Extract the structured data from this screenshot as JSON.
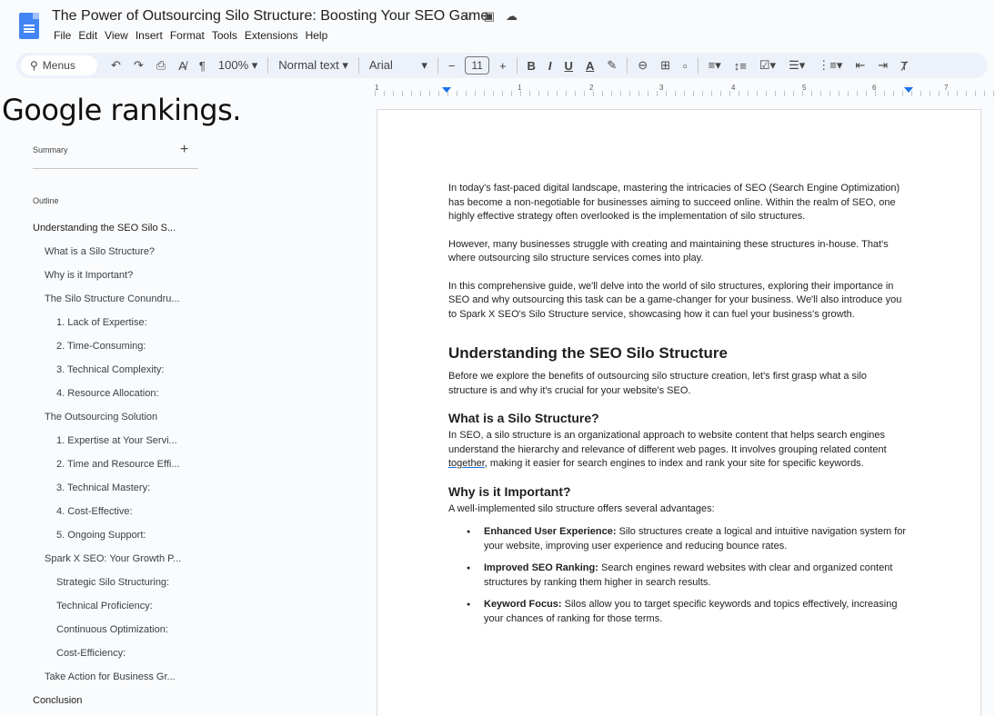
{
  "app": {
    "doc_title": "The Power of Outsourcing Silo Structure: Boosting Your SEO Game",
    "menu": [
      "File",
      "Edit",
      "View",
      "Insert",
      "Format",
      "Tools",
      "Extensions",
      "Help"
    ]
  },
  "toolbar": {
    "search_label": "Menus",
    "zoom": "100%",
    "style": "Normal text",
    "font": "Arial",
    "font_size": "11",
    "minus": "−",
    "plus": "+",
    "bold": "B",
    "italic": "I",
    "underline": "U",
    "text_color": "A"
  },
  "ruler": {
    "numbers": [
      "1",
      "1",
      "2",
      "3",
      "4",
      "5",
      "6",
      "7"
    ]
  },
  "overlay_text": "Google rankings.",
  "sidebar": {
    "summary_label": "Summary",
    "summary_add": "+",
    "outline_label": "Outline",
    "items": [
      {
        "label": "Understanding the SEO Silo S...",
        "level": 1
      },
      {
        "label": "What is a Silo Structure?",
        "level": 2
      },
      {
        "label": "Why is it Important?",
        "level": 2
      },
      {
        "label": "The Silo Structure Conundru...",
        "level": 2
      },
      {
        "label": "1. Lack of Expertise:",
        "level": 3
      },
      {
        "label": "2. Time-Consuming:",
        "level": 3
      },
      {
        "label": "3. Technical Complexity:",
        "level": 3
      },
      {
        "label": "4. Resource Allocation:",
        "level": 3
      },
      {
        "label": "The Outsourcing Solution",
        "level": 2
      },
      {
        "label": "1. Expertise at Your Servi...",
        "level": 3
      },
      {
        "label": "2. Time and Resource Effi...",
        "level": 3
      },
      {
        "label": "3. Technical Mastery:",
        "level": 3
      },
      {
        "label": "4. Cost-Effective:",
        "level": 3
      },
      {
        "label": "5. Ongoing Support:",
        "level": 3
      },
      {
        "label": "Spark X SEO: Your Growth P...",
        "level": 2
      },
      {
        "label": "Strategic Silo Structuring:",
        "level": 3
      },
      {
        "label": "Technical Proficiency:",
        "level": 3
      },
      {
        "label": "Continuous Optimization:",
        "level": 3
      },
      {
        "label": "Cost-Efficiency:",
        "level": 3
      },
      {
        "label": "Take Action for Business Gr...",
        "level": 2
      },
      {
        "label": "Conclusion",
        "level": 1
      }
    ]
  },
  "doc": {
    "intro_1": "In today's fast-paced digital landscape, mastering the intricacies of SEO (Search Engine Optimization) has become a non-negotiable for businesses aiming to succeed online. Within the realm of SEO, one highly effective strategy often overlooked is the implementation of silo structures.",
    "intro_2": "However, many businesses struggle with creating and maintaining these structures in-house. That's where outsourcing silo structure services comes into play.",
    "intro_3": "In this comprehensive guide, we'll delve into the world of silo structures, exploring their importance in SEO and why outsourcing this task can be a game-changer for your business. We'll also introduce you to Spark X SEO's Silo Structure service, showcasing how it can fuel your business's growth.",
    "h_understanding": "Understanding the SEO Silo Structure",
    "understanding_p": "Before we explore the benefits of outsourcing silo structure creation, let's first grasp what a silo structure is and why it's crucial for your website's SEO.",
    "h_what": "What is a Silo Structure?",
    "what_p_a": "In SEO, a silo structure is an organizational approach to website content that helps search engines understand the hierarchy and relevance of different web pages. It involves grouping related content ",
    "what_p_under": "together",
    "what_p_b": ", making it easier for search engines to index and rank your site for specific keywords.",
    "h_why": "Why is it Important?",
    "why_p": "A well-implemented silo structure offers several advantages:",
    "bullets": [
      {
        "bold": "Enhanced User Experience:",
        "text": " Silo structures create a logical and intuitive navigation system for your website, improving user experience and reducing bounce rates."
      },
      {
        "bold": "Improved SEO Ranking:",
        "text": " Search engines reward websites with clear and organized content structures by ranking them higher in search results."
      },
      {
        "bold": "Keyword Focus:",
        "text": " Silos allow you to target specific keywords and topics effectively, increasing your chances of ranking for those terms."
      }
    ]
  }
}
